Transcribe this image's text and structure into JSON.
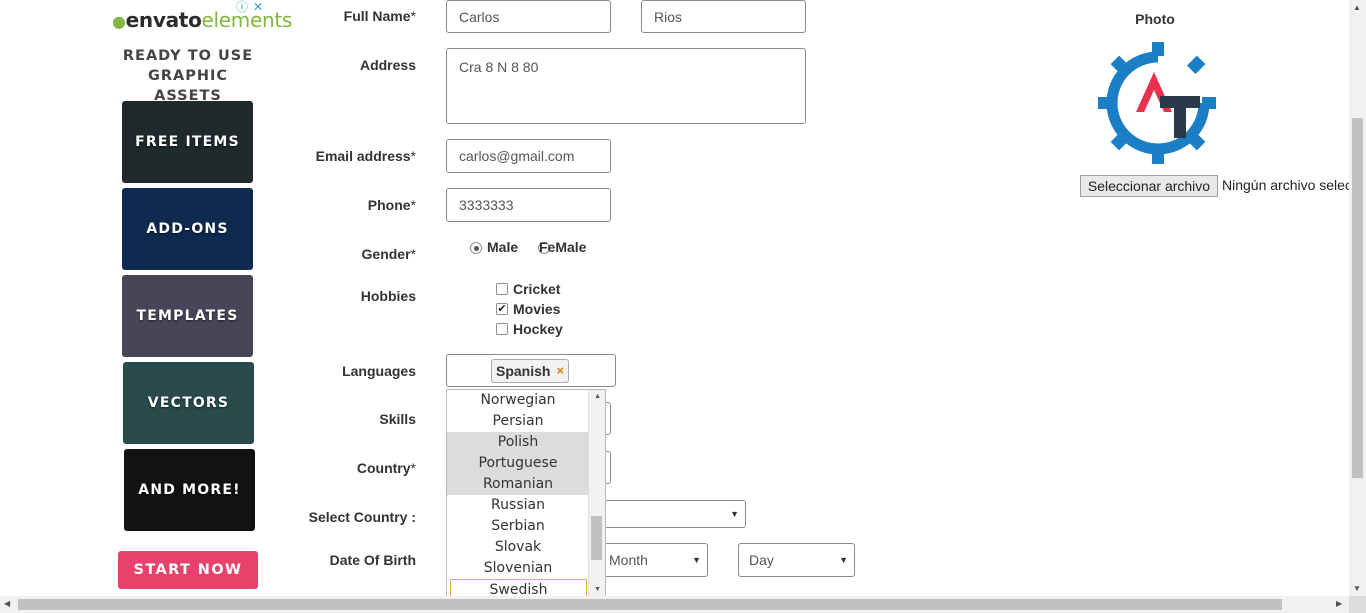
{
  "ad": {
    "brand_bold": "envato",
    "brand_light": "elements",
    "badge_info": "ⓘ",
    "badge_close": "✕",
    "headline": "READY TO USE\nGRAPHIC ASSETS",
    "tiles": [
      {
        "label": "FREE ITEMS",
        "bg": "#1f2a2c"
      },
      {
        "label": "ADD-ONS",
        "bg": "#0f2a4f"
      },
      {
        "label": "TEMPLATES",
        "bg": "#4a4458"
      },
      {
        "label": "VECTORS",
        "bg": "#2a4a4c"
      },
      {
        "label": "AND MORE!",
        "bg": "#121212"
      }
    ],
    "cta": "START NOW"
  },
  "form": {
    "full_name": {
      "label": "Full Name",
      "req": "*",
      "first": "Carlos",
      "last": "Rios"
    },
    "address": {
      "label": "Address",
      "value": "Cra 8 N 8 80"
    },
    "email": {
      "label": "Email address",
      "req": "*",
      "value": "carlos@gmail.com"
    },
    "phone": {
      "label": "Phone",
      "req": "*",
      "value": "3333333"
    },
    "gender": {
      "label": "Gender",
      "req": "*",
      "options": [
        "Male",
        "FeMale"
      ],
      "selected": "Male"
    },
    "hobbies": {
      "label": "Hobbies",
      "options": [
        {
          "label": "Cricket",
          "checked": false
        },
        {
          "label": "Movies",
          "checked": true
        },
        {
          "label": "Hockey",
          "checked": false
        }
      ]
    },
    "languages": {
      "label": "Languages",
      "tags": [
        "Spanish"
      ],
      "remove_glyph": "×"
    },
    "skills": {
      "label": "Skills"
    },
    "country": {
      "label": "Country",
      "req": "*"
    },
    "select_country": {
      "label": "Select Country :"
    },
    "dob": {
      "label": "Date Of Birth",
      "month": "Month",
      "day": "Day"
    }
  },
  "language_dropdown": {
    "items": [
      "Norwegian",
      "Persian",
      "Polish",
      "Portuguese",
      "Romanian",
      "Russian",
      "Serbian",
      "Slovak",
      "Slovenian",
      "Swedish"
    ],
    "highlighted": [
      "Polish",
      "Portuguese",
      "Romanian"
    ],
    "focused": "Swedish"
  },
  "photo": {
    "label": "Photo",
    "file_button": "Seleccionar archivo",
    "file_status": "Ningún archivo seleccionado"
  },
  "colors": {
    "logo_blue": "#1a7fc4",
    "logo_red": "#e8314f",
    "logo_dark": "#2b3a4a"
  }
}
